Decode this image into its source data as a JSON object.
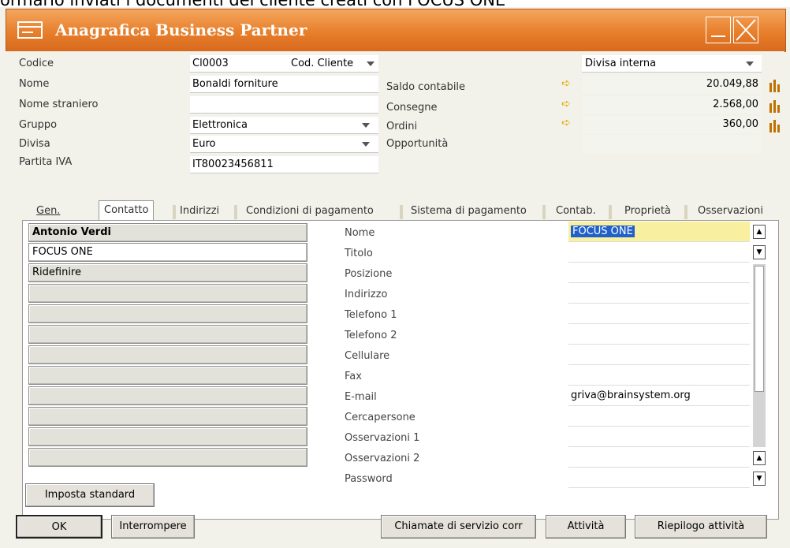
{
  "caption": "ormario inviati i documenti del cliente creati con FOCUS ONE",
  "window": {
    "title": "Anagrafica Business Partner"
  },
  "header": {
    "codice_label": "Codice",
    "codice_value": "Cl0003",
    "cod_type": "Cod. Cliente",
    "nome_label": "Nome",
    "nome_value": "Bonaldi forniture",
    "nome_straniero_label": "Nome straniero",
    "nome_straniero_value": "",
    "gruppo_label": "Gruppo",
    "gruppo_value": "Elettronica",
    "divisa_label": "Divisa",
    "divisa_value": "Euro",
    "partita_iva_label": "Partita IVA",
    "partita_iva_value": "IT80023456811"
  },
  "balances": {
    "currency_select": "Divisa interna",
    "rows": [
      {
        "label": "Saldo contabile",
        "value": "20.049,88"
      },
      {
        "label": "Consegne",
        "value": "2.568,00"
      },
      {
        "label": "Ordini",
        "value": "360,00"
      },
      {
        "label": "Opportunità",
        "value": ""
      }
    ]
  },
  "tabs": [
    {
      "label": "Gen."
    },
    {
      "label": "Contatto"
    },
    {
      "label": "Indirizzi"
    },
    {
      "label": "Condizioni di pagamento"
    },
    {
      "label": "Sistema di pagamento"
    },
    {
      "label": "Contab."
    },
    {
      "label": "Proprietà"
    },
    {
      "label": "Osservazioni"
    }
  ],
  "contacts": [
    "Antonio Verdi",
    "FOCUS ONE",
    "Ridefinire"
  ],
  "contact_details": [
    {
      "label": "Nome",
      "value": "FOCUS ONE"
    },
    {
      "label": "Titolo",
      "value": ""
    },
    {
      "label": "Posizione",
      "value": ""
    },
    {
      "label": "Indirizzo",
      "value": ""
    },
    {
      "label": "Telefono 1",
      "value": ""
    },
    {
      "label": "Telefono 2",
      "value": ""
    },
    {
      "label": "Cellulare",
      "value": ""
    },
    {
      "label": "Fax",
      "value": ""
    },
    {
      "label": "E-mail",
      "value": "griva@brainsystem.org"
    },
    {
      "label": "Cercapersone",
      "value": ""
    },
    {
      "label": "Osservazioni 1",
      "value": ""
    },
    {
      "label": "Osservazioni 2",
      "value": ""
    },
    {
      "label": "Password",
      "value": ""
    }
  ],
  "buttons": {
    "set_default": "Imposta standard",
    "ok": "OK",
    "cancel": "Interrompere",
    "service_calls": "Chiamate di servizio corr",
    "activity": "Attività",
    "activity_summary": "Riepilogo attività"
  },
  "colors": {
    "title_orange": "#e77f2b",
    "selection_yellow": "#f8f0a0",
    "selection_blue": "#2060c8"
  }
}
